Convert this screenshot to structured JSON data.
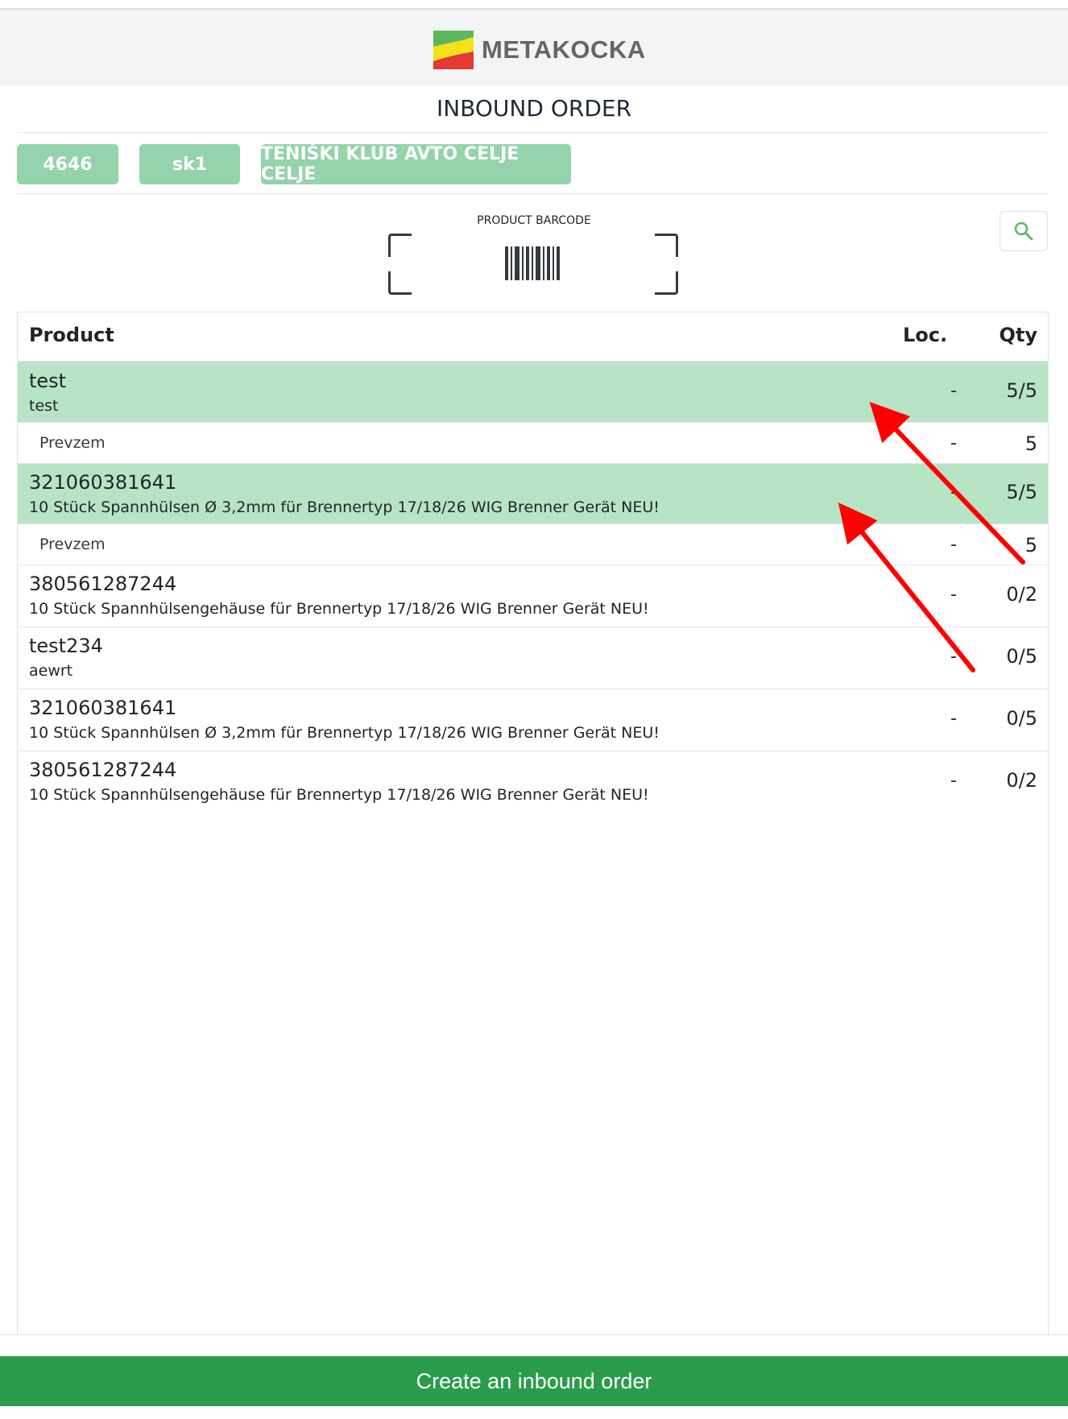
{
  "header": {
    "brand": "METAKOCKA"
  },
  "page": {
    "title": "INBOUND ORDER"
  },
  "chips": [
    "4646",
    "sk1",
    "TENIŠKI KLUB AVTO CELJE CELJE"
  ],
  "scanner": {
    "label": "PRODUCT BARCODE"
  },
  "table": {
    "columns": {
      "product": "Product",
      "loc": "Loc.",
      "qty": "Qty"
    },
    "rows": [
      {
        "code": "test",
        "desc": "test",
        "loc": "-",
        "qty": "5/5",
        "done": true
      },
      {
        "sub": "Prevzem",
        "loc": "-",
        "qty": "5"
      },
      {
        "code": "321060381641",
        "desc": "10 Stück Spannhülsen Ø 3,2mm für Brennertyp 17/18/26 WIG Brenner Gerät NEU!",
        "loc": "-",
        "qty": "5/5",
        "done": true
      },
      {
        "sub": "Prevzem",
        "loc": "-",
        "qty": "5"
      },
      {
        "code": "380561287244",
        "desc": "10 Stück Spannhülsengehäuse für Brennertyp 17/18/26 WIG Brenner Gerät NEU!",
        "loc": "-",
        "qty": "0/2",
        "done": false
      },
      {
        "code": "test234",
        "desc": "aewrt",
        "loc": "-",
        "qty": "0/5",
        "done": false
      },
      {
        "code": "321060381641",
        "desc": "10 Stück Spannhülsen Ø 3,2mm für Brennertyp 17/18/26 WIG Brenner Gerät NEU!",
        "loc": "-",
        "qty": "0/5",
        "done": false
      },
      {
        "code": "380561287244",
        "desc": "10 Stück Spannhülsengehäuse für Brennertyp 17/18/26 WIG Brenner Gerät NEU!",
        "loc": "-",
        "qty": "0/2",
        "done": false
      }
    ]
  },
  "footer": {
    "button_label": "Create an inbound order"
  },
  "colors": {
    "accent": "#2b9c4c",
    "row_done": "#b8e4c6",
    "chip": "#94d3ab",
    "annotation": "#ff0000"
  },
  "icons": {
    "logo": "metakocka-logo",
    "search": "search-icon",
    "barcode": "barcode-icon"
  }
}
